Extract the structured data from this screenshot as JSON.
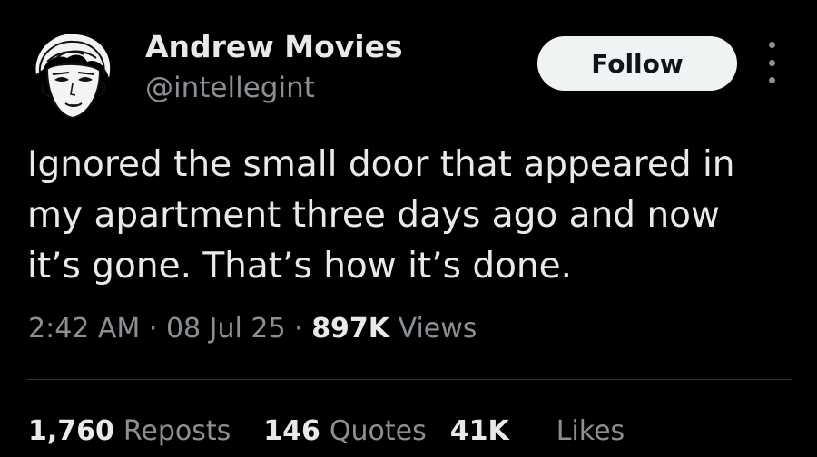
{
  "author": {
    "display_name": "Andrew Movies",
    "handle": "@intellegint",
    "avatar_icon": "avatar-illustrated-face-icon"
  },
  "header": {
    "follow_label": "Follow",
    "more_icon": "more-vertical-dots-icon"
  },
  "tweet": {
    "lines": [
      "Ignored the small door that appeared in",
      "my apartment three days ago and now",
      "it’s gone. That’s how it’s done."
    ]
  },
  "meta": {
    "time": "2:42 AM",
    "separator": "·",
    "date": "08 Jul 25",
    "views_count": "897K",
    "views_label": "Views"
  },
  "stats": {
    "reposts_count": "1,760",
    "reposts_label": "Reposts",
    "quotes_count": "146",
    "quotes_label": "Quotes",
    "likes_count": "41K",
    "likes_label": "Likes"
  },
  "colors": {
    "background": "#000000",
    "primary_text": "#e7e9ea",
    "secondary_text": "#8b9095",
    "follow_button_bg": "#eff3f4",
    "follow_button_text": "#0f1419",
    "divider": "#2f3336"
  }
}
